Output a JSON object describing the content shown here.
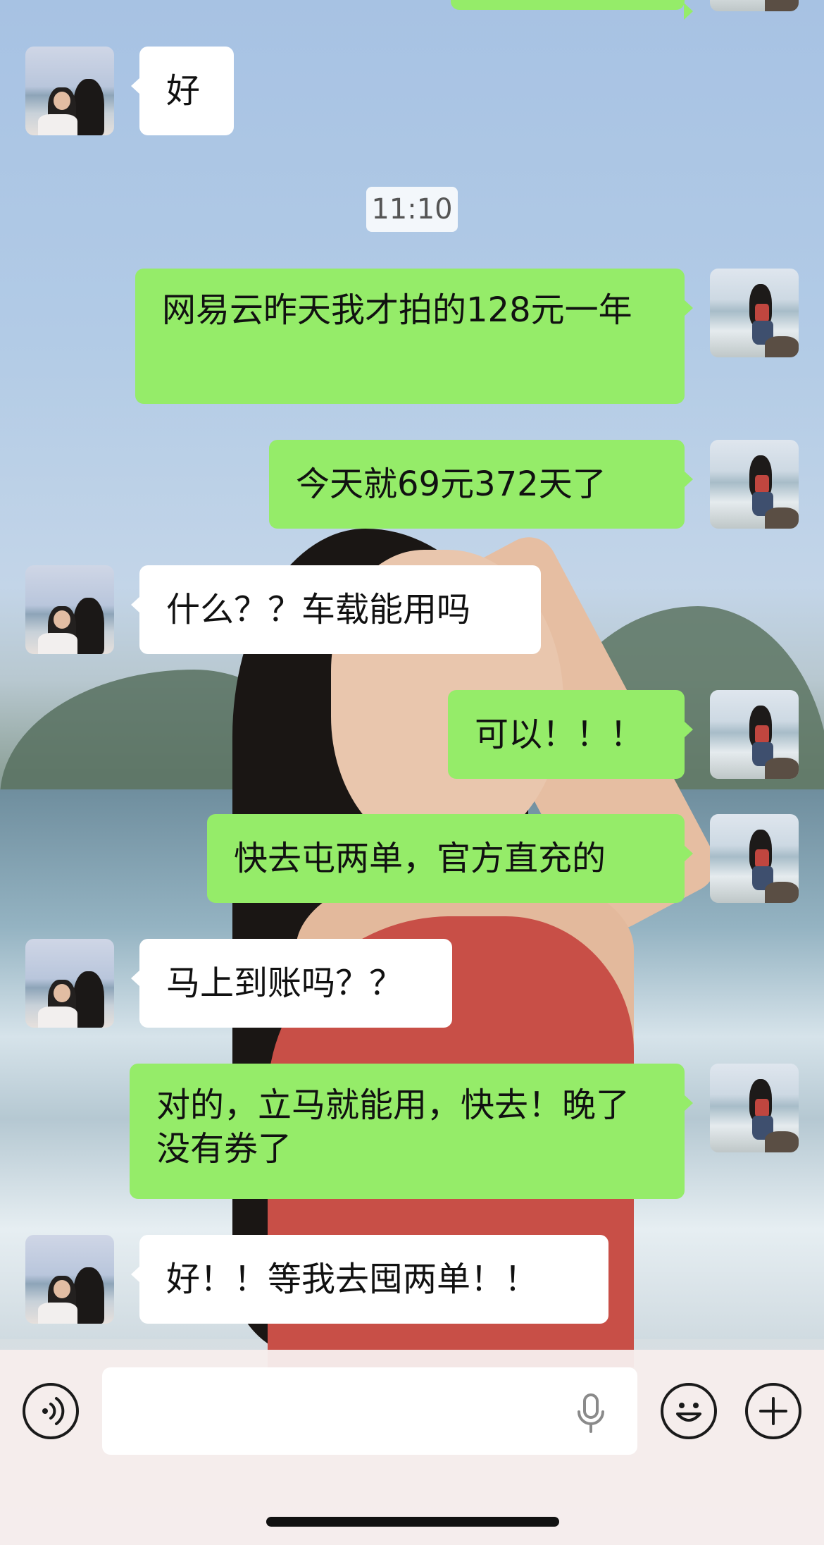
{
  "chat": {
    "timestamp": "11:10",
    "messages": [
      {
        "from": "other",
        "text": "好"
      },
      {
        "from": "self",
        "text": "网易云昨天我才拍的128元一年"
      },
      {
        "from": "self",
        "text": "今天就69元372天了"
      },
      {
        "from": "other",
        "text": "什么？？车载能用吗"
      },
      {
        "from": "self",
        "text": "可以！！！"
      },
      {
        "from": "self",
        "text": "快去屯两单，官方直充的"
      },
      {
        "from": "other",
        "text": "马上到账吗？？"
      },
      {
        "from": "self",
        "text": "对的，立马就能用，快去！晚了没有券了"
      },
      {
        "from": "other",
        "text": "好！！等我去囤两单！！"
      }
    ]
  },
  "input_bar": {
    "voice_icon": "voice-icon",
    "mic_icon": "microphone-icon",
    "emoji_icon": "emoji-icon",
    "plus_icon": "plus-icon",
    "placeholder": ""
  },
  "colors": {
    "self_bubble": "#95ec69",
    "other_bubble": "#ffffff"
  }
}
